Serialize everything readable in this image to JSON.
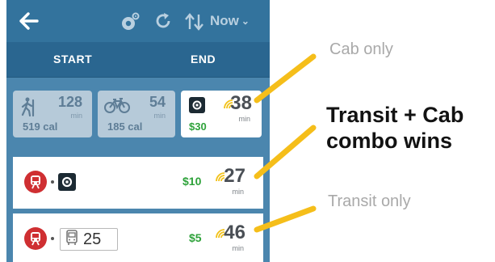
{
  "topbar": {
    "time_label": "Now",
    "icons": [
      "back-arrow-icon",
      "camera-settings-icon",
      "refresh-icon",
      "swap-direction-icon",
      "chevron-down-icon"
    ]
  },
  "route_bar": {
    "start_label": "START",
    "end_label": "END"
  },
  "modes": {
    "walk": {
      "icon": "walk-icon",
      "minutes": "128",
      "unit": "min",
      "calories": "519 cal"
    },
    "bike": {
      "icon": "bike-icon",
      "minutes": "54",
      "unit": "min",
      "calories": "185 cal"
    },
    "cab": {
      "icon": "uber-icon",
      "minutes": "38",
      "unit": "min",
      "price": "$30"
    }
  },
  "results": [
    {
      "icons": [
        "rail-icon",
        "uber-icon"
      ],
      "price": "$10",
      "minutes": "27",
      "unit": "min"
    },
    {
      "icons": [
        "rail-icon",
        "bus-icon"
      ],
      "bus_route": "25",
      "price": "$5",
      "minutes": "46",
      "unit": "min"
    }
  ],
  "annotations": {
    "cab_only": "Cab only",
    "combo_line1": "Transit + Cab",
    "combo_line2": "combo wins",
    "transit_only": "Transit only"
  },
  "colors": {
    "header_blue": "#33739d",
    "panel_blue": "#4b86ae",
    "price_green": "#2ea23a",
    "rail_red": "#cf2f32",
    "arrow_yellow": "#f5be1a"
  }
}
